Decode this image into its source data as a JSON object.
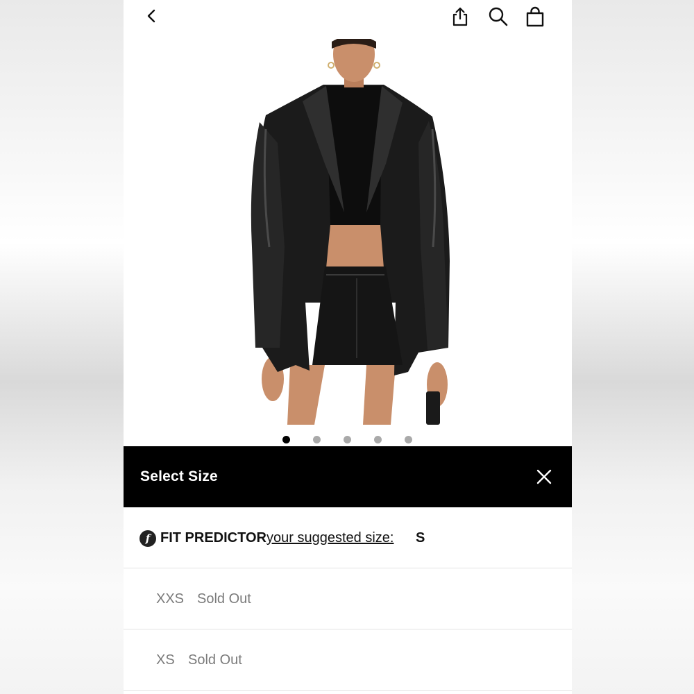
{
  "header": {
    "back_icon": "chevron-left-icon",
    "share_icon": "share-icon",
    "search_icon": "search-icon",
    "bag_icon": "shopping-bag-icon"
  },
  "product_image": {
    "description_icon": "product-photo",
    "carousel": {
      "total": 5,
      "active_index": 0
    }
  },
  "size_panel": {
    "title": "Select Size",
    "close_icon": "close-icon",
    "fit_predictor": {
      "logo_glyph": "f",
      "label": "FIT PREDICTOR",
      "link_text": "your suggested size:",
      "suggested_size": "S"
    },
    "sizes": [
      {
        "size": "XXS",
        "status": "Sold Out"
      },
      {
        "size": "XS",
        "status": "Sold Out"
      }
    ]
  },
  "colors": {
    "header_bg": "#000000",
    "header_text": "#ffffff",
    "dot_active": "#000000",
    "dot_inactive": "#a9a9a9",
    "sold_out_text": "#7a7a7a"
  }
}
